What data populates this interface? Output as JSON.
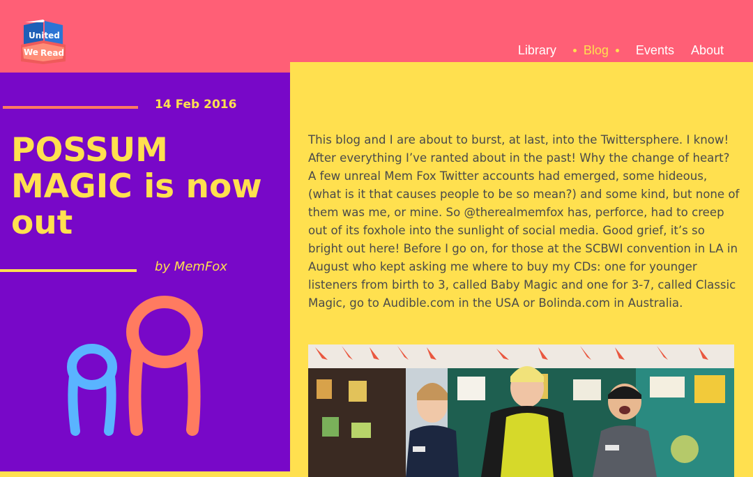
{
  "header": {
    "logo_words": [
      "United",
      "We",
      "Read"
    ],
    "nav": [
      "Library",
      "Blog",
      "Events",
      "About"
    ],
    "active_nav": "Blog"
  },
  "post": {
    "date": "14 Feb 2016",
    "title": "POSSUM MAGIC is now out",
    "byline": "by MemFox",
    "body": "This blog and I are about to burst, at last, into the Twittersphere. I know! After everything I’ve ranted about in the past! Why the change of heart? A few unreal Mem Fox Twitter accounts had emerged, some hideous, (what is it that causes people to be so mean?) and some kind, but none of them was me, or mine. So @therealmemfox has, perforce, had to creep out of its foxhole into the sunlight of social media. Good grief, it’s so bright out here! Before I go on, for those at the SCBWI convention in LA in August who kept asking me where to buy my CDs: one for younger listeners from birth to 3, called Baby Magic and one for 3-7, called Classic Magic, go to Audible.com in the USA or Bolinda.com in Australia."
  },
  "colors": {
    "header": "#ff5f76",
    "panel": "#7808c8",
    "accent_yellow": "#ffe04f",
    "accent_orange": "#ff7b60",
    "figure_blue": "#5ab4ff",
    "text": "#4a4a4a"
  }
}
